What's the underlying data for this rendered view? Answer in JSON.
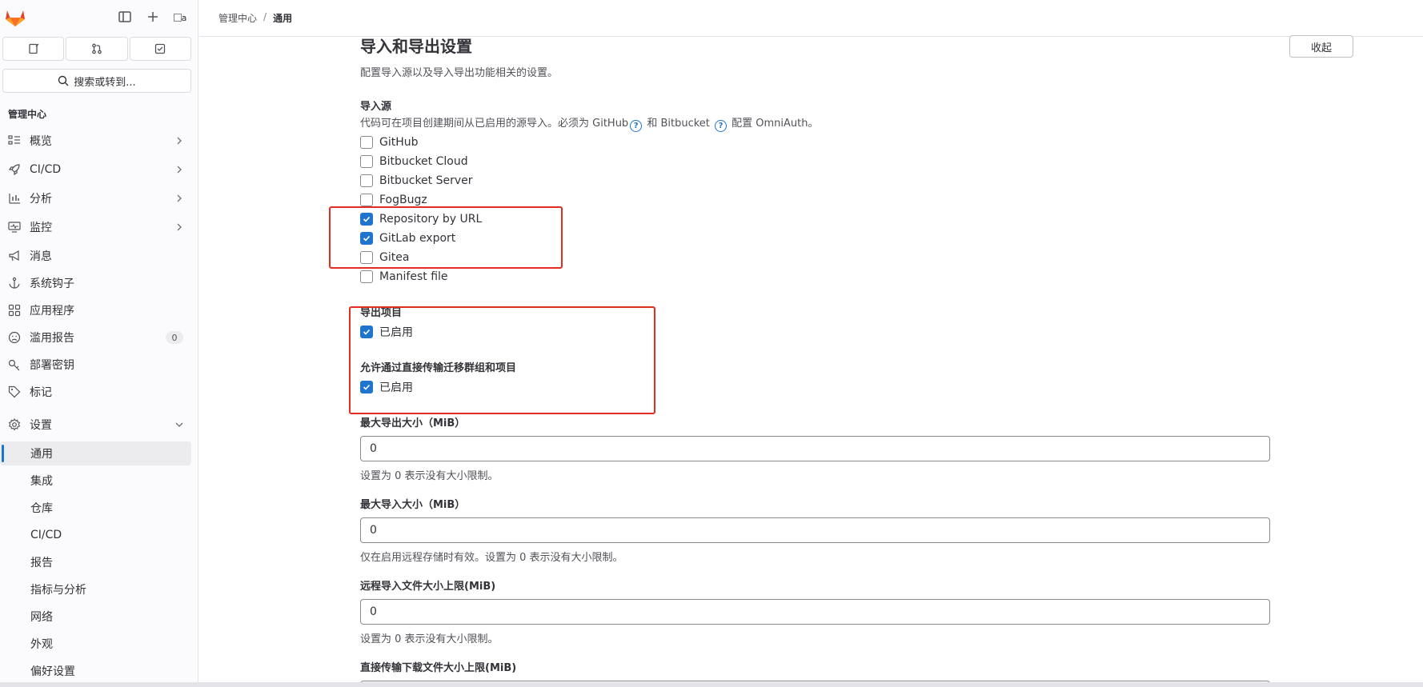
{
  "sidebar": {
    "avatar_alt": "a",
    "search_label": "搜索或转到...",
    "section_title": "管理中心",
    "items": [
      {
        "label": "概览",
        "icon": "overview-icon",
        "chevron": true
      },
      {
        "label": "CI/CD",
        "icon": "rocket-icon",
        "chevron": true
      },
      {
        "label": "分析",
        "icon": "chart-icon",
        "chevron": true
      },
      {
        "label": "监控",
        "icon": "monitor-icon",
        "chevron": true
      },
      {
        "label": "消息",
        "icon": "bullhorn-icon",
        "chevron": false
      },
      {
        "label": "系统钩子",
        "icon": "anchor-icon",
        "chevron": false
      },
      {
        "label": "应用程序",
        "icon": "applications-icon",
        "chevron": false
      },
      {
        "label": "滥用报告",
        "icon": "abuse-icon",
        "badge": "0"
      },
      {
        "label": "部署密钥",
        "icon": "key-icon",
        "chevron": false
      },
      {
        "label": "标记",
        "icon": "label-icon",
        "chevron": false
      },
      {
        "label": "设置",
        "icon": "settings-icon",
        "expanded": true
      }
    ],
    "settings_children": [
      "通用",
      "集成",
      "仓库",
      "CI/CD",
      "报告",
      "指标与分析",
      "网络",
      "外观",
      "偏好设置"
    ]
  },
  "breadcrumb": {
    "parent": "管理中心",
    "current": "通用"
  },
  "section": {
    "title": "导入和导出设置",
    "collapse_label": "收起",
    "description": "配置导入源以及导入导出功能相关的设置。"
  },
  "import_sources": {
    "label": "导入源",
    "help_prefix": "代码可在项目创建期间从已启用的源导入。必须为 GitHub",
    "help_middle": " 和 Bitbucket ",
    "help_suffix": " 配置 OmniAuth。",
    "options": [
      {
        "label": "GitHub",
        "checked": false
      },
      {
        "label": "Bitbucket Cloud",
        "checked": false
      },
      {
        "label": "Bitbucket Server",
        "checked": false
      },
      {
        "label": "FogBugz",
        "checked": false
      },
      {
        "label": "Repository by URL",
        "checked": true
      },
      {
        "label": "GitLab export",
        "checked": true
      },
      {
        "label": "Gitea",
        "checked": false
      },
      {
        "label": "Manifest file",
        "checked": false
      }
    ]
  },
  "export_project": {
    "label": "导出项目",
    "option_label": "已启用",
    "checked": true
  },
  "direct_transfer": {
    "label": "允许通过直接传输迁移群组和项目",
    "option_label": "已启用",
    "checked": true
  },
  "max_export_size": {
    "label": "最大导出大小（MiB）",
    "value": "0",
    "help": "设置为 0 表示没有大小限制。"
  },
  "max_import_size": {
    "label": "最大导入大小（MiB）",
    "value": "0",
    "help": "仅在启用远程存储时有效。设置为 0 表示没有大小限制。"
  },
  "remote_import_size": {
    "label": "远程导入文件大小上限(MiB)",
    "value": "0",
    "help": "设置为 0 表示没有大小限制。"
  },
  "direct_download_size": {
    "label": "直接传输下载文件大小上限(MiB)"
  },
  "colors": {
    "accent": "#1f75cb",
    "highlight": "#e42d20"
  }
}
